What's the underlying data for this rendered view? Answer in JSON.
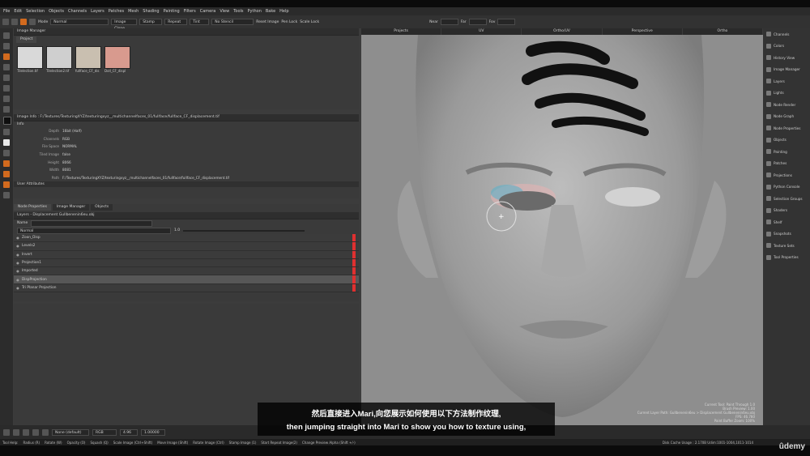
{
  "menus": [
    "File",
    "Edit",
    "Selection",
    "Objects",
    "Channels",
    "Layers",
    "Patches",
    "Mesh",
    "Shading",
    "Painting",
    "Filters",
    "Camera",
    "View",
    "Tools",
    "Python",
    "Bake",
    "Help"
  ],
  "toolbar": {
    "mode_label": "Mode",
    "mode_value": "Normal",
    "image_clone": "Image Clone",
    "stamp": "Stamp",
    "repeat": "Repeat",
    "tint": "Tint",
    "no_stencil": "No Stencil",
    "reset_image": "Reset Image",
    "pen_lock": "Pen Lock",
    "scale_lock": "Scale Lock",
    "near_label": "Near",
    "far_label": "Far",
    "fov_label": "Fov"
  },
  "image_manager": {
    "title": "Image Manager",
    "tab": "Project",
    "thumbs": [
      {
        "caption": "Tilelection.tif",
        "color": "#d9d9d9"
      },
      {
        "caption": "Tilelection2.tif",
        "color": "#cfcfcf"
      },
      {
        "caption": "fullface_CF_dis",
        "color": "#c9bfb0"
      },
      {
        "caption": "Doll_CF_displ",
        "color": "#d89a8e"
      }
    ]
  },
  "image_info": {
    "header": "Image Info : F:/Textures/TexturingXYZ/texturingxyz__multichannelfaces_01/fullface/fullface_CF_displacement.tif",
    "section": "Info",
    "rows": [
      {
        "key": "Depth",
        "value": "16bit (Half)"
      },
      {
        "key": "Channels",
        "value": "RGB"
      },
      {
        "key": "File Space",
        "value": "NORMAL"
      },
      {
        "key": "Tiled Image",
        "value": "false"
      },
      {
        "key": "Height",
        "value": "8066"
      },
      {
        "key": "Width",
        "value": "8081"
      },
      {
        "key": "Path",
        "value": "F:/Textures/TexturingXYZ/texturingxyz__multichannelfaces_01/fullface/fullface_CF_displacement.tif"
      }
    ],
    "user_attributes": "User Attributes"
  },
  "bottom_tabs": [
    "Node Properties",
    "Image Manager",
    "Objects"
  ],
  "layers": {
    "title": "Layers - Displacement Gullbenenin6eu.obj",
    "filter_label": "Name",
    "blend": "Normal",
    "opacity": "1.0",
    "rows": [
      {
        "name": "Zoon_Disp",
        "sel": false
      },
      {
        "name": "Levels2",
        "sel": false
      },
      {
        "name": "Invert",
        "sel": false
      },
      {
        "name": "Projection1",
        "sel": false
      },
      {
        "name": "Imported",
        "sel": false
      },
      {
        "name": "DispProjection",
        "sel": true
      },
      {
        "name": "Tri Planar Projection",
        "sel": false
      }
    ]
  },
  "viewport": {
    "tabs": [
      "Projects",
      "UV",
      "Ortho/UV",
      "Perspective",
      "Ortho"
    ],
    "info_lines": [
      "Current Tool: Paint Through 1.0",
      "Brush Preview: 1.00",
      "Current Layer Path: Gullbenenin6eu > Displacement Gullbenenin6eu.obj",
      "FPS: 46.780",
      "Paint Buffer Zoom: 100%"
    ]
  },
  "right_panel": [
    "Channels",
    "Colors",
    "History View",
    "Image Manager",
    "Layers",
    "Lights",
    "Node Render",
    "Node Graph",
    "Node Properties",
    "Objects",
    "Painting",
    "Patches",
    "Projections",
    "Python Console",
    "Selection Groups",
    "Shaders",
    "Shelf",
    "Snapshots",
    "Texture Sets",
    "Tool Properties"
  ],
  "bottom_toolbar": {
    "channel": "None (default)",
    "format": "RGB",
    "size": "4.96",
    "value": "1.00000"
  },
  "status": {
    "items": [
      "Tool Help:",
      "Radius (R)",
      "Rotate (W)",
      "Opacity (O)",
      "Squash (Q)",
      "Scale Image (Ctrl+Shift)",
      "Move Image (Shift)",
      "Rotate Image (Ctrl)",
      "Stamp Image (1)",
      "Start Repeat Image(2)",
      "Change Preview Alpha (Shift +/-)"
    ],
    "right": "Disk Cache Usage : 2.170B  Udim:1001-1004,1011-1014"
  },
  "subtitle": {
    "zh": "然后直接进入Mari,向您展示如何使用以下方法制作纹理,",
    "en": "then jumping straight into Mari to show you how to texture using,"
  },
  "watermark": "ûdemy",
  "colors": {
    "accent": "#d26a1e",
    "layer_marker": "#e03030"
  }
}
